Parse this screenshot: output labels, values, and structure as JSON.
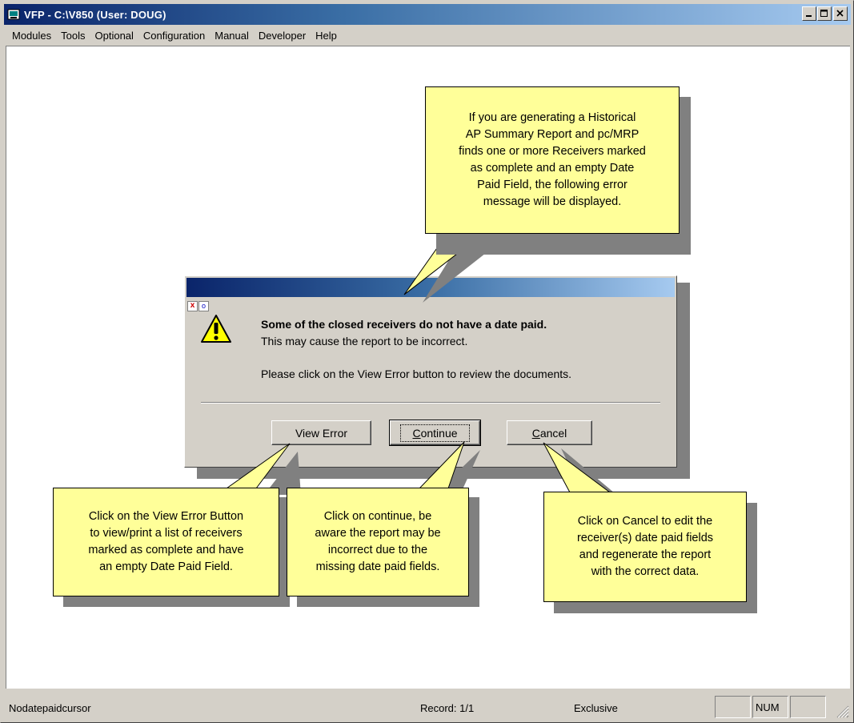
{
  "window": {
    "title": "VFP - C:\\V850  (User: DOUG)",
    "caption_buttons": [
      "minimize-icon",
      "maximize-icon",
      "close-icon"
    ]
  },
  "menu": [
    "Modules",
    "Tools",
    "Optional",
    "Configuration",
    "Manual",
    "Developer",
    "Help"
  ],
  "dialog": {
    "message_bold": "Some of the closed receivers do not have a date paid.",
    "message_line2": "This may cause the report to be incorrect.",
    "message_line3": "Please click on the View Error button to review the documents.",
    "buttons": {
      "view_error": "View Error",
      "continue_prefix": "",
      "continue_mnemonic": "C",
      "continue_rest": "ontinue",
      "cancel_mnemonic": "C",
      "cancel_rest": "ancel"
    },
    "mini_icons": {
      "x": "x",
      "o": "o"
    }
  },
  "callouts": {
    "top": [
      "If you are generating a Historical",
      "AP Summary Report and pc/MRP",
      "finds one or more Receivers marked",
      "as complete and an empty Date",
      "Paid Field, the following error",
      "message will be displayed."
    ],
    "view_error": [
      "Click on the View Error Button",
      "to view/print a list of receivers",
      "marked as complete and have",
      "an empty Date Paid Field."
    ],
    "continue": [
      "Click on continue, be",
      "aware the report may be",
      "incorrect due to the",
      "missing date paid fields."
    ],
    "cancel": [
      "Click on Cancel to edit the",
      "receiver(s) date paid fields",
      "and regenerate the report",
      "with the correct data."
    ]
  },
  "status": {
    "cursor": "Nodatepaidcursor",
    "record": "Record: 1/1",
    "mode": "Exclusive",
    "num": "NUM"
  },
  "colors": {
    "title_gradient_start": "#0a246a",
    "title_gradient_end": "#a6caf0",
    "callout_fill": "#ffff99",
    "face": "#d4d0c8"
  }
}
